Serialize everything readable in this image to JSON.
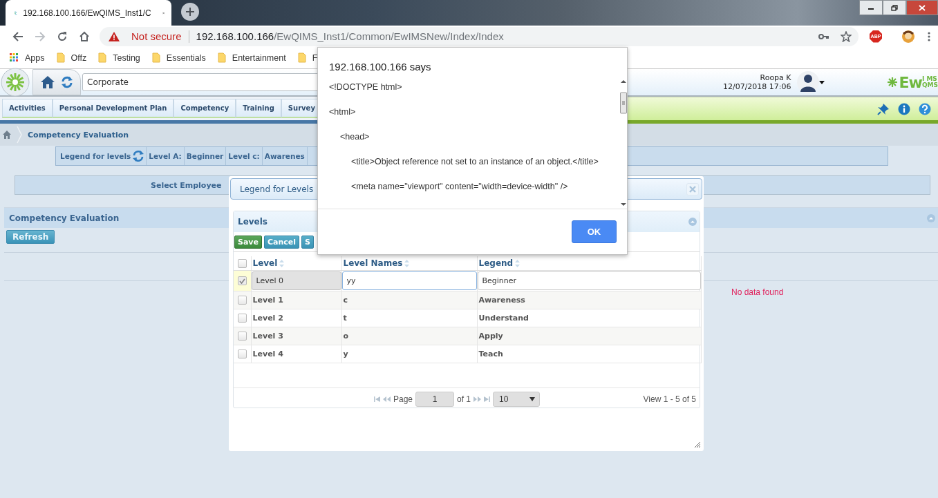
{
  "browser": {
    "tab_title": "192.168.100.166/EwQIMS_Inst1/C",
    "security": "Not secure",
    "url_host": "192.168.100.166",
    "url_path": "/EwQIMS_Inst1/Common/EwIMSNew/Index/Index",
    "extension_badge": "ABP",
    "bookmarks": [
      {
        "kind": "apps",
        "label": "Apps"
      },
      {
        "kind": "folder",
        "label": "Offz"
      },
      {
        "kind": "folder",
        "label": "Testing"
      },
      {
        "kind": "folder",
        "label": "Essentials"
      },
      {
        "kind": "folder",
        "label": "Entertainment"
      },
      {
        "kind": "folder",
        "label": "F"
      }
    ]
  },
  "header": {
    "organization": "Corporate",
    "user": "Roopa K",
    "datetime": "12/07/2018 17:06",
    "logo_main": "Ew",
    "logo_top": "I MS",
    "logo_bottom": "QMS"
  },
  "menu": [
    "Activities",
    "Personal Development Plan",
    "Competency",
    "Training",
    "Survey"
  ],
  "breadcrumb": "Competency Evaluation",
  "legend_bar": {
    "title": "Legend for levels",
    "items": [
      "Level A:",
      "Beginner",
      "Level c:",
      "Awarenes"
    ]
  },
  "select_employee": "Select Employee",
  "panel": {
    "title": "Competency Evaluation",
    "refresh": "Refresh",
    "empty": "No data found"
  },
  "legend_dialog": {
    "title": "Legend for Levels",
    "grid_title": "Levels",
    "buttons": [
      {
        "kind": "save",
        "label": "Save"
      },
      {
        "kind": "cancel",
        "label": "Cancel"
      },
      {
        "kind": "other",
        "label": "S"
      }
    ],
    "columns": [
      "Level",
      "Level Names",
      "Legend"
    ],
    "all_checked": false,
    "rows": [
      {
        "level": "Level 0",
        "name": "yy",
        "legend": "Beginner",
        "checked": true,
        "editing": true
      },
      {
        "level": "Level 1",
        "name": "c",
        "legend": "Awareness",
        "checked": false,
        "editing": false
      },
      {
        "level": "Level 2",
        "name": "t",
        "legend": "Understand",
        "checked": false,
        "editing": false
      },
      {
        "level": "Level 3",
        "name": "o",
        "legend": "Apply",
        "checked": false,
        "editing": false
      },
      {
        "level": "Level 4",
        "name": "y",
        "legend": "Teach",
        "checked": false,
        "editing": false
      }
    ],
    "pager": {
      "page_label": "Page",
      "page": "1",
      "of": "of 1",
      "page_size": "10",
      "view": "View 1 - 5 of 5"
    }
  },
  "alert": {
    "title": "192.168.100.166 says",
    "lines": [
      "<!DOCTYPE html>",
      "<html>",
      "<head>",
      "<title>Object reference not set to an instance of an object.</title>",
      "<meta name=\"viewport\" content=\"width=device-width\" />"
    ],
    "ok": "OK"
  }
}
